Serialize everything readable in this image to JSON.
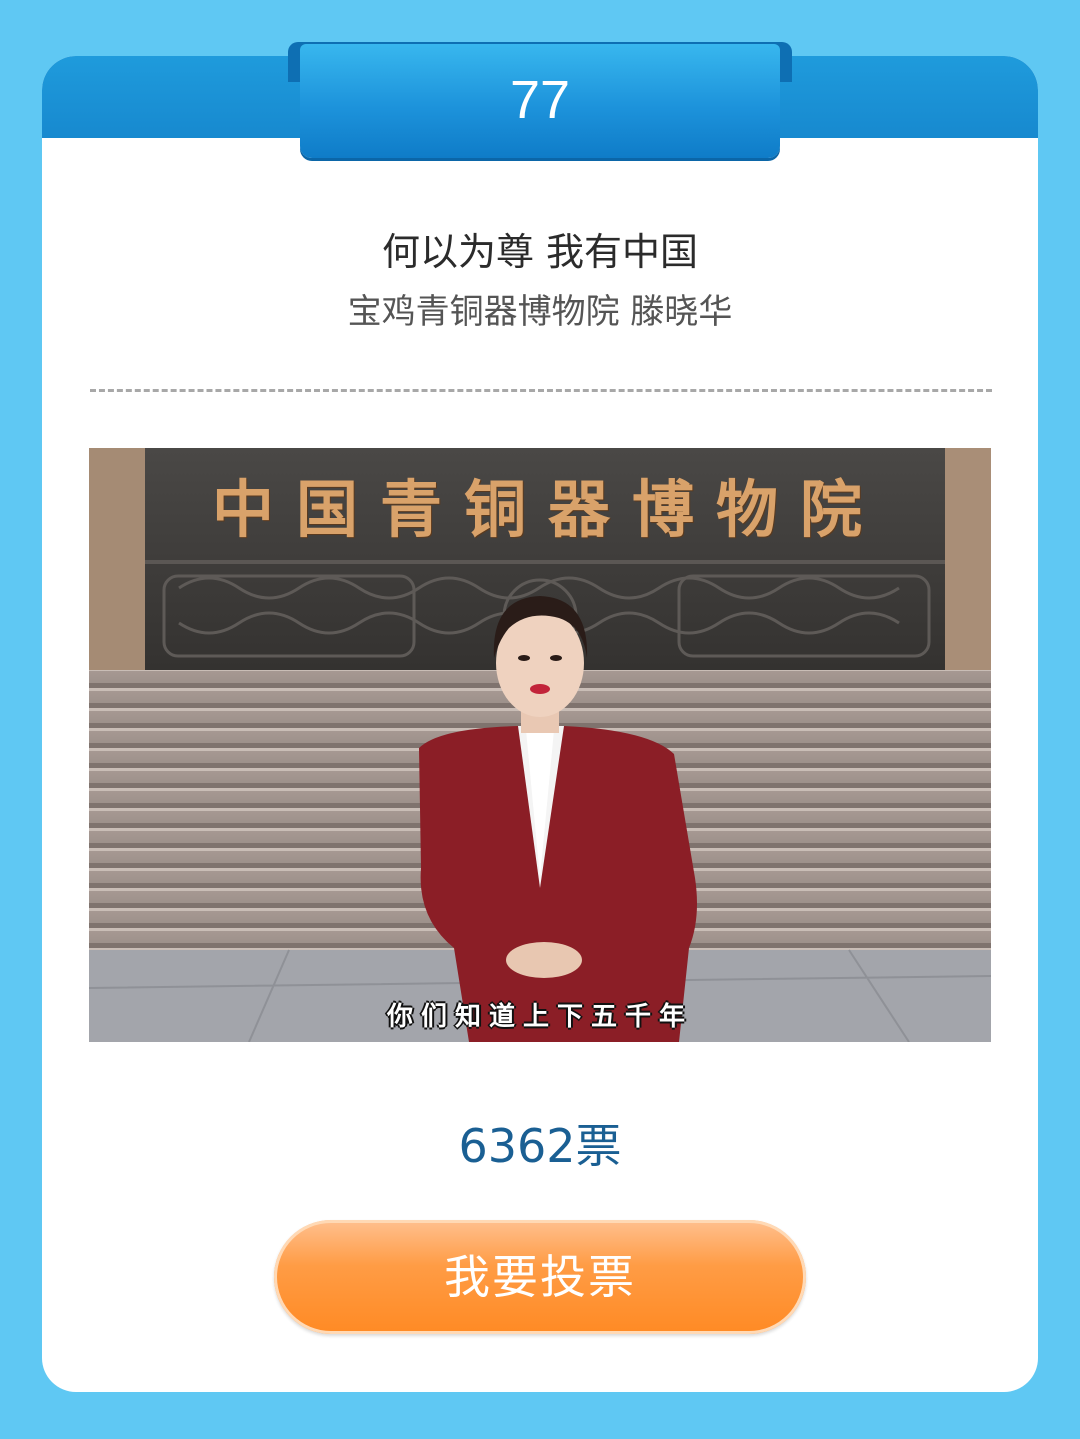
{
  "entry": {
    "number": "77",
    "title": "何以为尊 我有中国",
    "subtitle": "宝鸡青铜器博物院 滕晓华"
  },
  "video": {
    "sign_chars": [
      "中",
      "国",
      "青",
      "铜",
      "器",
      "博",
      "物",
      "院"
    ],
    "caption": "你们知道上下五千年"
  },
  "votes": {
    "count_text": "6362票"
  },
  "vote_button": {
    "label": "我要投票"
  },
  "colors": {
    "page_background": "#5fc8f3",
    "header_blue": "#1789cf",
    "votes_text": "#1a5f93",
    "button_orange": "#ff8a24"
  }
}
